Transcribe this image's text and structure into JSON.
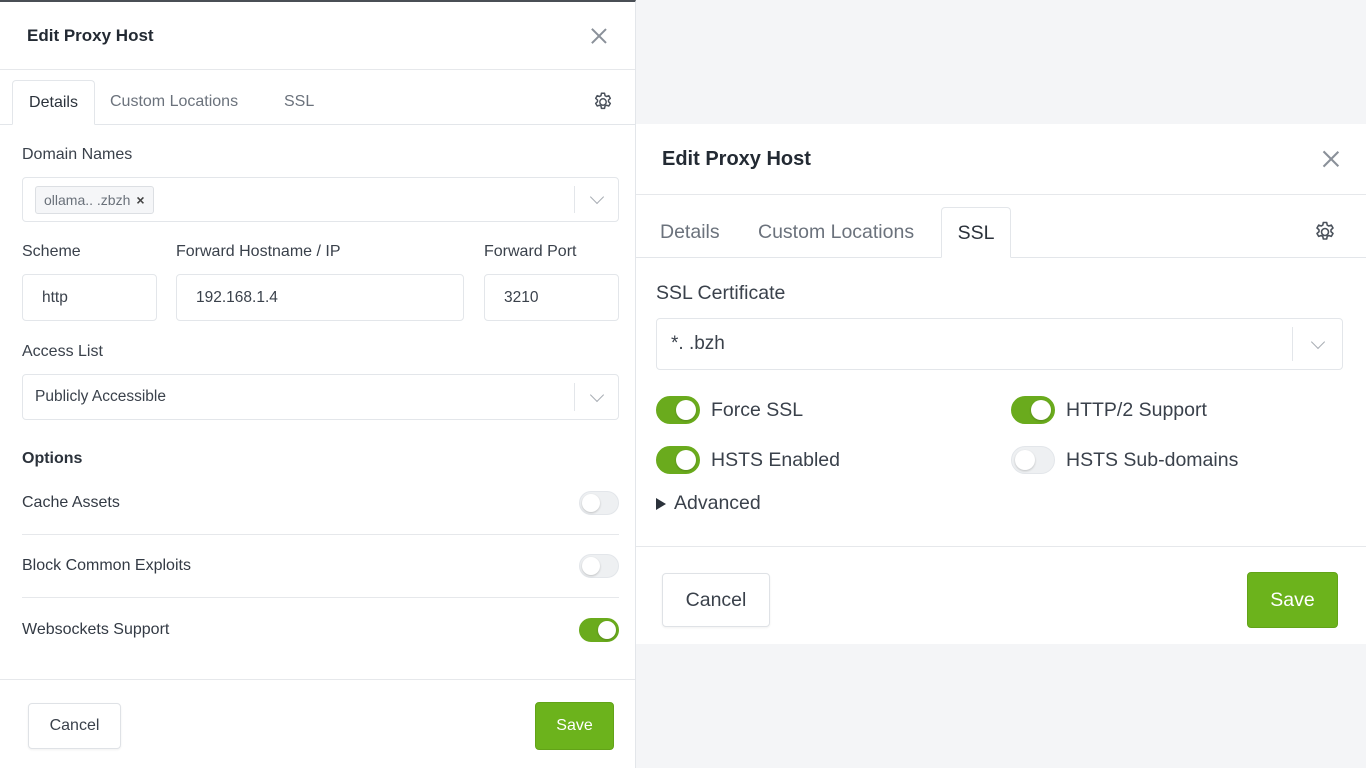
{
  "left": {
    "title": "Edit Proxy Host",
    "tabs": [
      {
        "label": "Details",
        "active": true
      },
      {
        "label": "Custom Locations",
        "active": false
      },
      {
        "label": "SSL",
        "active": false
      }
    ],
    "domain_names_label": "Domain Names",
    "domain_chip": "ollama..       .zbzh",
    "scheme_label": "Scheme",
    "scheme_value": "http",
    "forward_host_label": "Forward Hostname / IP",
    "forward_host_value": "192.168.1.4",
    "forward_port_label": "Forward Port",
    "forward_port_value": "3210",
    "access_list_label": "Access List",
    "access_list_value": "Publicly Accessible",
    "options_heading": "Options",
    "options": [
      {
        "label": "Cache Assets",
        "on": false
      },
      {
        "label": "Block Common Exploits",
        "on": false
      },
      {
        "label": "Websockets Support",
        "on": true
      }
    ],
    "cancel_label": "Cancel",
    "save_label": "Save"
  },
  "right": {
    "title": "Edit Proxy Host",
    "tabs": [
      {
        "label": "Details",
        "active": false
      },
      {
        "label": "Custom Locations",
        "active": false
      },
      {
        "label": "SSL",
        "active": true
      }
    ],
    "ssl_cert_label": "SSL Certificate",
    "ssl_cert_value": "*.        .bzh",
    "toggles": [
      {
        "label": "Force SSL",
        "on": true
      },
      {
        "label": "HTTP/2 Support",
        "on": true
      },
      {
        "label": "HSTS Enabled",
        "on": true
      },
      {
        "label": "HSTS Sub-domains",
        "on": false
      }
    ],
    "advanced_label": "Advanced",
    "cancel_label": "Cancel",
    "save_label": "Save"
  },
  "colors": {
    "accent": "#6cb31c",
    "toggle_on": "#6aab1d"
  }
}
